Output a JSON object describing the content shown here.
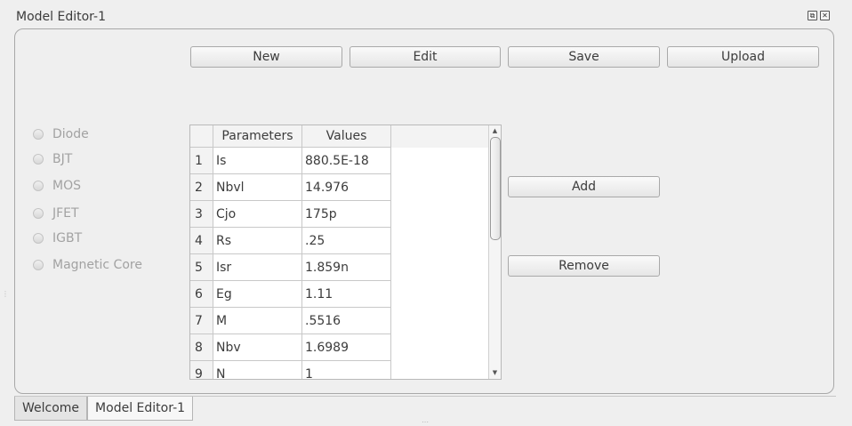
{
  "window": {
    "title": "Model Editor-1"
  },
  "toolbar": {
    "new_label": "New",
    "edit_label": "Edit",
    "save_label": "Save",
    "upload_label": "Upload"
  },
  "device_types": [
    {
      "label": "Diode"
    },
    {
      "label": "BJT"
    },
    {
      "label": "MOS"
    },
    {
      "label": "JFET"
    },
    {
      "label": "IGBT"
    },
    {
      "label": "Magnetic Core"
    }
  ],
  "table": {
    "headers": {
      "params": "Parameters",
      "values": "Values"
    },
    "rows": [
      {
        "n": "1",
        "param": "Is",
        "value": "880.5E-18"
      },
      {
        "n": "2",
        "param": "Nbvl",
        "value": "14.976"
      },
      {
        "n": "3",
        "param": "Cjo",
        "value": "175p"
      },
      {
        "n": "4",
        "param": "Rs",
        "value": ".25"
      },
      {
        "n": "5",
        "param": "Isr",
        "value": "1.859n"
      },
      {
        "n": "6",
        "param": "Eg",
        "value": "1.11"
      },
      {
        "n": "7",
        "param": "M",
        "value": ".5516"
      },
      {
        "n": "8",
        "param": "Nbv",
        "value": "1.6989"
      },
      {
        "n": "9",
        "param": "N",
        "value": "1"
      }
    ]
  },
  "actions": {
    "add_label": "Add",
    "remove_label": "Remove"
  },
  "tabs": [
    {
      "label": "Welcome"
    },
    {
      "label": "Model Editor-1"
    }
  ]
}
